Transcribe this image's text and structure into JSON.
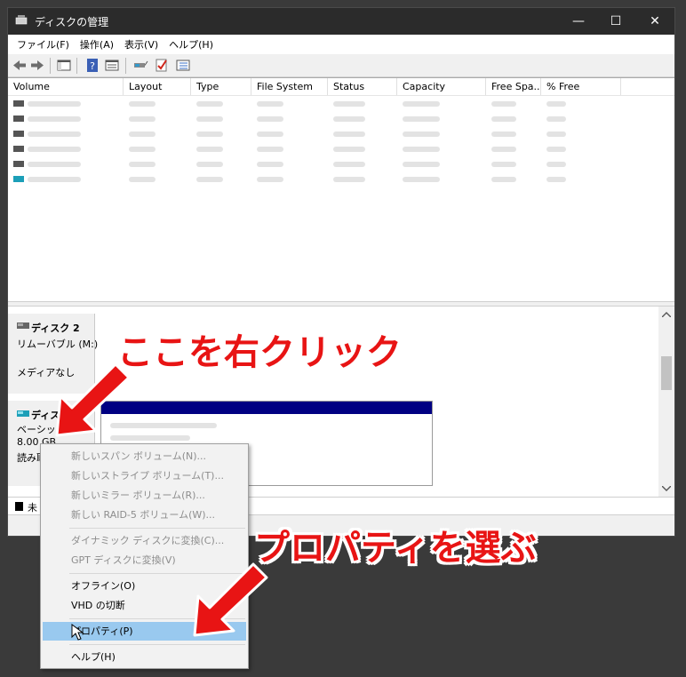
{
  "window": {
    "title": "ディスクの管理",
    "minimize_glyph": "—",
    "maximize_glyph": "☐",
    "close_glyph": "✕"
  },
  "menubar": [
    "ファイル(F)",
    "操作(A)",
    "表示(V)",
    "ヘルプ(H)"
  ],
  "toolbar": {
    "icons": [
      "back-icon",
      "forward-icon",
      "console-tree-icon",
      "help-icon",
      "properties-icon",
      "connect-icon",
      "check-icon",
      "list-icon"
    ]
  },
  "volume_list": {
    "columns": [
      "Volume",
      "Layout",
      "Type",
      "File System",
      "Status",
      "Capacity",
      "Free Spa...",
      "% Free"
    ],
    "row_count_blurred": 6
  },
  "disk_pane": {
    "disk2": {
      "name": "ディスク 2",
      "type": "リムーバブル (M:)",
      "media": "メディアなし"
    },
    "disk3": {
      "name": "ディスク",
      "type": "ベーシック",
      "size": "8.00 GB",
      "status": "読み取"
    },
    "legend_text": "未"
  },
  "context_menu": {
    "items": [
      {
        "label": "新しいスパン ボリューム(N)...",
        "enabled": false
      },
      {
        "label": "新しいストライプ ボリューム(T)...",
        "enabled": false
      },
      {
        "label": "新しいミラー ボリューム(R)...",
        "enabled": false
      },
      {
        "label": "新しい RAID-5 ボリューム(W)...",
        "enabled": false
      },
      {
        "label": "ダイナミック ディスクに変換(C)...",
        "enabled": false
      },
      {
        "label": "GPT ディスクに変換(V)",
        "enabled": false
      },
      {
        "label": "オフライン(O)",
        "enabled": true
      },
      {
        "label": "VHD の切断",
        "enabled": true
      },
      {
        "label": "プロパティ(P)",
        "enabled": true,
        "highlighted": true
      },
      {
        "label": "ヘルプ(H)",
        "enabled": true
      }
    ]
  },
  "annotations": {
    "right_click": "ここを右クリック",
    "choose_properties": "プロパティを選ぶ"
  },
  "colors": {
    "accent_red": "#e81414",
    "partition_bar": "#000082",
    "menu_highlight": "#99c9ef",
    "titlebar": "#2b2b2b"
  }
}
